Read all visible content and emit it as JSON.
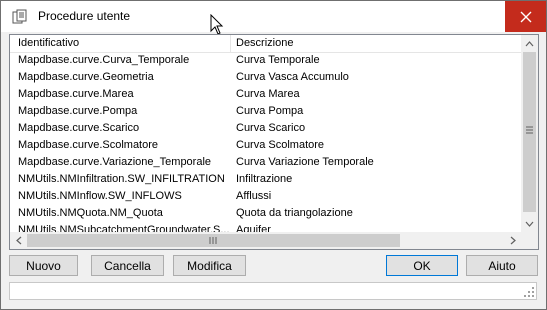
{
  "window": {
    "title": "Procedure utente"
  },
  "list": {
    "headers": {
      "identifier": "Identificativo",
      "description": "Descrizione"
    },
    "rows": [
      {
        "id": "Mapdbase.curve.Curva_Temporale",
        "desc": "Curva Temporale"
      },
      {
        "id": "Mapdbase.curve.Geometria",
        "desc": "Curva Vasca Accumulo"
      },
      {
        "id": "Mapdbase.curve.Marea",
        "desc": "Curva Marea"
      },
      {
        "id": "Mapdbase.curve.Pompa",
        "desc": "Curva Pompa"
      },
      {
        "id": "Mapdbase.curve.Scarico",
        "desc": "Curva Scarico"
      },
      {
        "id": "Mapdbase.curve.Scolmatore",
        "desc": "Curva Scolmatore"
      },
      {
        "id": "Mapdbase.curve.Variazione_Temporale",
        "desc": "Curva Variazione Temporale"
      },
      {
        "id": "NMUtils.NMInfiltration.SW_INFILTRATION",
        "desc": "Infiltrazione"
      },
      {
        "id": "NMUtils.NMInflow.SW_INFLOWS",
        "desc": "Afflussi"
      },
      {
        "id": "NMUtils.NMQuota.NM_Quota",
        "desc": "Quota da triangolazione"
      },
      {
        "id": "NMUtils.NMSubcatchmentGroundwater.S...",
        "desc": "Aquifer"
      }
    ]
  },
  "buttons": {
    "new": "Nuovo",
    "delete": "Cancella",
    "edit": "Modifica",
    "ok": "OK",
    "help": "Aiuto"
  },
  "colors": {
    "close_button": "#c42b1c",
    "titlebar": "#ffffff",
    "dialog": "#f0f0f0"
  }
}
